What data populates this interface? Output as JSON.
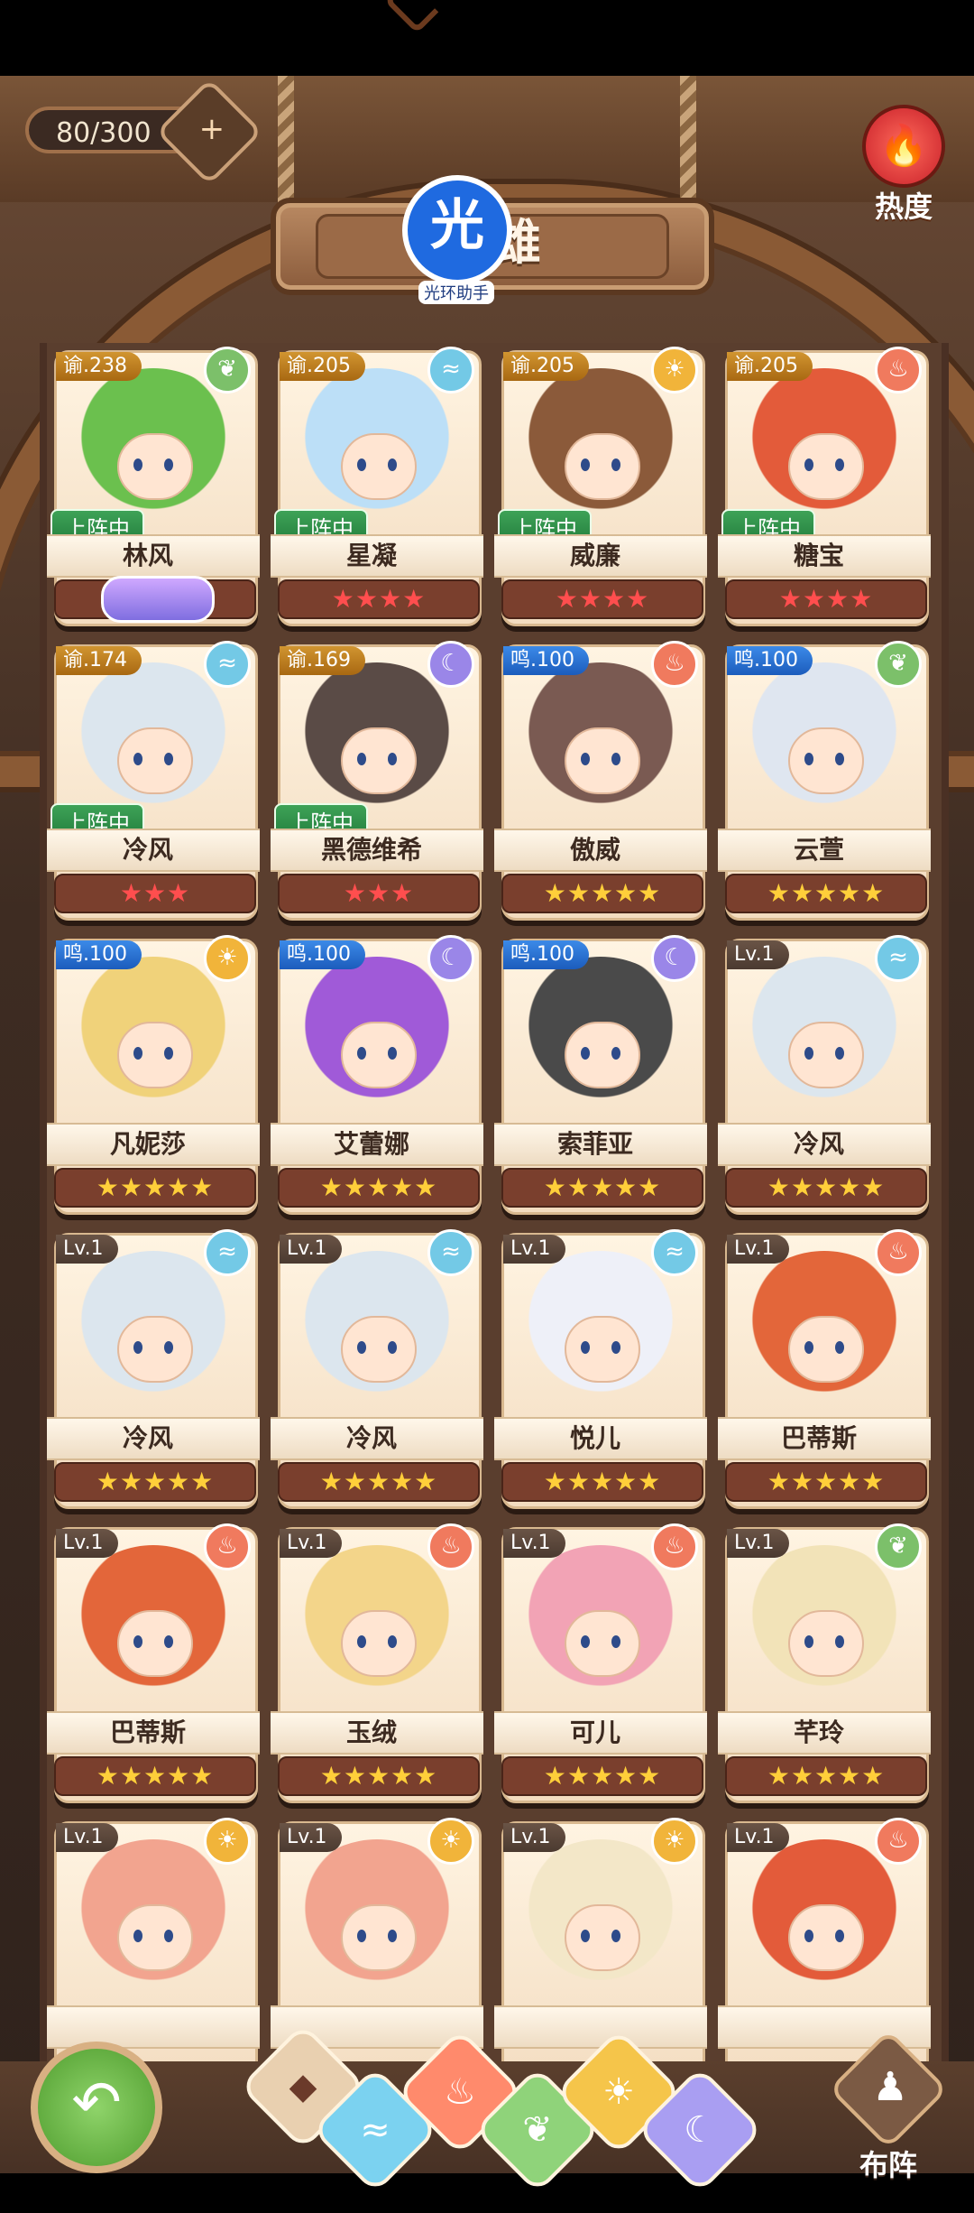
{
  "top": {
    "counter": "80/300",
    "title": "英雄",
    "hot_label": "热度",
    "watermark_badge": "光",
    "watermark_caption": "光环助手"
  },
  "icons": {
    "wind": "wind-icon",
    "fire": "fire-icon",
    "leaf": "leaf-icon",
    "moon": "moon-icon",
    "sun": "sun-icon"
  },
  "labels": {
    "deployed": "上阵中"
  },
  "heroes": [
    {
      "tag": "谕.238",
      "tag_style": "gold",
      "element": "leaf",
      "deployed": true,
      "name": "林风",
      "stars": "★★★★",
      "star_color": "red",
      "hair": "#6bc04e"
    },
    {
      "tag": "谕.205",
      "tag_style": "gold",
      "element": "wind",
      "deployed": true,
      "name": "星凝",
      "stars": "★★★★",
      "star_color": "red",
      "hair": "#bcdff7"
    },
    {
      "tag": "谕.205",
      "tag_style": "gold",
      "element": "sun",
      "deployed": true,
      "name": "威廉",
      "stars": "★★★★",
      "star_color": "red",
      "hair": "#8b5a3a"
    },
    {
      "tag": "谕.205",
      "tag_style": "gold",
      "element": "fire",
      "deployed": true,
      "name": "糖宝",
      "stars": "★★★★",
      "star_color": "red",
      "hair": "#e35b3a"
    },
    {
      "tag": "谕.174",
      "tag_style": "gold",
      "element": "wind",
      "deployed": true,
      "name": "冷风",
      "stars": "★★★",
      "star_color": "red",
      "hair": "#dce6ee"
    },
    {
      "tag": "谕.169",
      "tag_style": "gold",
      "element": "moon",
      "deployed": true,
      "name": "黑德维希",
      "stars": "★★★",
      "star_color": "red",
      "hair": "#5a4b46"
    },
    {
      "tag": "鸣.100",
      "tag_style": "blue",
      "element": "fire",
      "deployed": false,
      "name": "傲威",
      "stars": "★★★★★",
      "star_color": "gold",
      "hair": "#7a5a52"
    },
    {
      "tag": "鸣.100",
      "tag_style": "blue",
      "element": "leaf",
      "deployed": false,
      "name": "云萱",
      "stars": "★★★★★",
      "star_color": "gold",
      "hair": "#dfe6f0"
    },
    {
      "tag": "鸣.100",
      "tag_style": "blue",
      "element": "sun",
      "deployed": false,
      "name": "凡妮莎",
      "stars": "★★★★★",
      "star_color": "gold",
      "hair": "#f0d27a"
    },
    {
      "tag": "鸣.100",
      "tag_style": "blue",
      "element": "moon",
      "deployed": false,
      "name": "艾蕾娜",
      "stars": "★★★★★",
      "star_color": "gold",
      "hair": "#a05ad8"
    },
    {
      "tag": "鸣.100",
      "tag_style": "blue",
      "element": "moon",
      "deployed": false,
      "name": "索菲亚",
      "stars": "★★★★★",
      "star_color": "gold",
      "hair": "#4a4a4a"
    },
    {
      "tag": "Lv.1",
      "tag_style": "dark",
      "element": "wind",
      "deployed": false,
      "name": "冷风",
      "stars": "★★★★★",
      "star_color": "gold",
      "hair": "#dce6ee"
    },
    {
      "tag": "Lv.1",
      "tag_style": "dark",
      "element": "wind",
      "deployed": false,
      "name": "冷风",
      "stars": "★★★★★",
      "star_color": "gold",
      "hair": "#dce6ee"
    },
    {
      "tag": "Lv.1",
      "tag_style": "dark",
      "element": "wind",
      "deployed": false,
      "name": "冷风",
      "stars": "★★★★★",
      "star_color": "gold",
      "hair": "#dce6ee"
    },
    {
      "tag": "Lv.1",
      "tag_style": "dark",
      "element": "wind",
      "deployed": false,
      "name": "悦儿",
      "stars": "★★★★★",
      "star_color": "gold",
      "hair": "#eef0f8"
    },
    {
      "tag": "Lv.1",
      "tag_style": "dark",
      "element": "fire",
      "deployed": false,
      "name": "巴蒂斯",
      "stars": "★★★★★",
      "star_color": "gold",
      "hair": "#e3663a"
    },
    {
      "tag": "Lv.1",
      "tag_style": "dark",
      "element": "fire",
      "deployed": false,
      "name": "巴蒂斯",
      "stars": "★★★★★",
      "star_color": "gold",
      "hair": "#e3663a"
    },
    {
      "tag": "Lv.1",
      "tag_style": "dark",
      "element": "fire",
      "deployed": false,
      "name": "玉绒",
      "stars": "★★★★★",
      "star_color": "gold",
      "hair": "#f3d58a"
    },
    {
      "tag": "Lv.1",
      "tag_style": "dark",
      "element": "fire",
      "deployed": false,
      "name": "可儿",
      "stars": "★★★★★",
      "star_color": "gold",
      "hair": "#f2a3b5"
    },
    {
      "tag": "Lv.1",
      "tag_style": "dark",
      "element": "leaf",
      "deployed": false,
      "name": "芊玲",
      "stars": "★★★★★",
      "star_color": "gold",
      "hair": "#f2e3b8"
    },
    {
      "tag": "Lv.1",
      "tag_style": "dark",
      "element": "sun",
      "deployed": false,
      "name": "",
      "stars": "",
      "star_color": "gold",
      "hair": "#f2a48f"
    },
    {
      "tag": "Lv.1",
      "tag_style": "dark",
      "element": "sun",
      "deployed": false,
      "name": "",
      "stars": "",
      "star_color": "gold",
      "hair": "#f2a48f"
    },
    {
      "tag": "Lv.1",
      "tag_style": "dark",
      "element": "sun",
      "deployed": false,
      "name": "",
      "stars": "",
      "star_color": "gold",
      "hair": "#f3e7c8"
    },
    {
      "tag": "Lv.1",
      "tag_style": "dark",
      "element": "fire",
      "deployed": false,
      "name": "",
      "stars": "",
      "star_color": "gold",
      "hair": "#e35b3a"
    }
  ],
  "bottom": {
    "back_icon": "back-arrow-icon",
    "filters": [
      "all",
      "wind",
      "fire",
      "leaf",
      "sun",
      "moon"
    ],
    "formation_label": "布阵"
  }
}
